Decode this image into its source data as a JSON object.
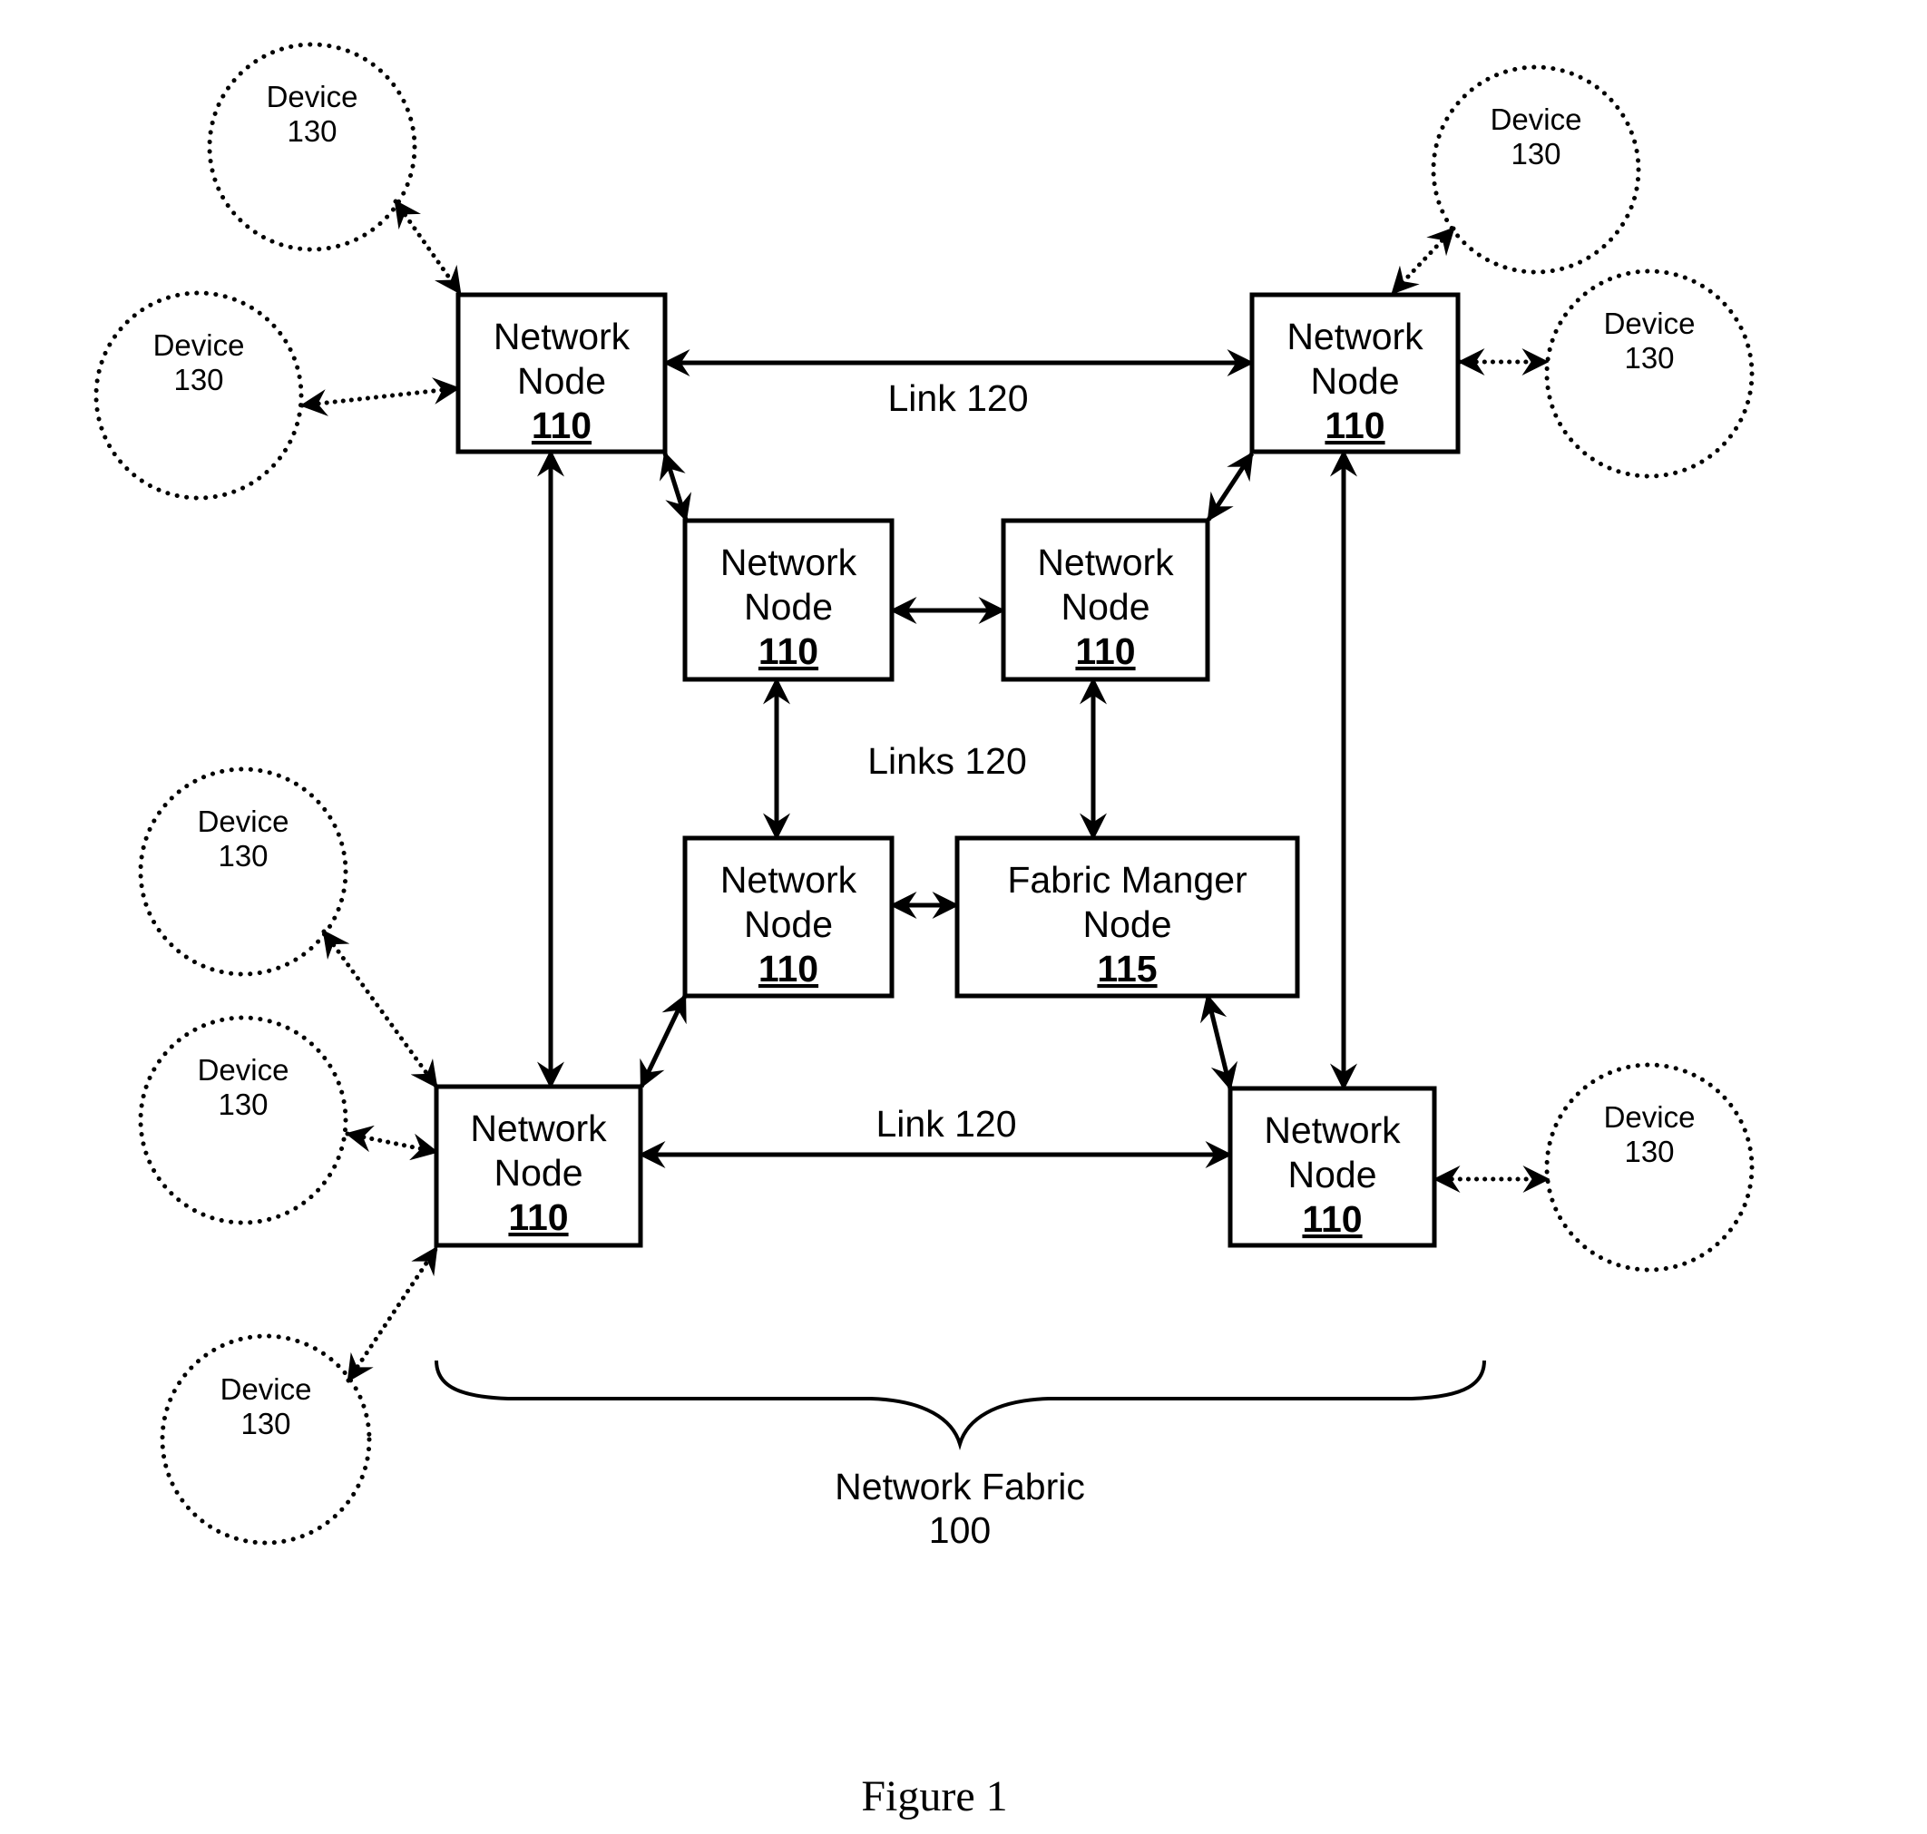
{
  "figure": {
    "caption": "Figure 1",
    "fabric_label": "Network Fabric",
    "fabric_id": "100"
  },
  "link_labels": {
    "top": "Link 120",
    "middle": "Links 120",
    "bottom": "Link 120"
  },
  "nodes": [
    {
      "key": "node-top-left",
      "line1": "Network",
      "line2": "Node",
      "id": "110"
    },
    {
      "key": "node-top-right",
      "line1": "Network",
      "line2": "Node",
      "id": "110"
    },
    {
      "key": "node-inner-top-left",
      "line1": "Network",
      "line2": "Node",
      "id": "110"
    },
    {
      "key": "node-inner-top-right",
      "line1": "Network",
      "line2": "Node",
      "id": "110"
    },
    {
      "key": "node-inner-bottom-left",
      "line1": "Network",
      "line2": "Node",
      "id": "110"
    },
    {
      "key": "fabric-manager-node",
      "line1": "Fabric Manger",
      "line2": "Node",
      "id": "115"
    },
    {
      "key": "node-bottom-left",
      "line1": "Network",
      "line2": "Node",
      "id": "110"
    },
    {
      "key": "node-bottom-right",
      "line1": "Network",
      "line2": "Node",
      "id": "110"
    }
  ],
  "devices": [
    {
      "key": "device-top-left-upper",
      "label": "Device",
      "id": "130",
      "attached_to": "node-top-left"
    },
    {
      "key": "device-top-left-lower",
      "label": "Device",
      "id": "130",
      "attached_to": "node-top-left"
    },
    {
      "key": "device-top-right-upper",
      "label": "Device",
      "id": "130",
      "attached_to": "node-top-right"
    },
    {
      "key": "device-top-right-lower",
      "label": "Device",
      "id": "130",
      "attached_to": "node-top-right"
    },
    {
      "key": "device-bottom-left-upper",
      "label": "Device",
      "id": "130",
      "attached_to": "node-bottom-left"
    },
    {
      "key": "device-bottom-left-middle",
      "label": "Device",
      "id": "130",
      "attached_to": "node-bottom-left"
    },
    {
      "key": "device-bottom-left-lower",
      "label": "Device",
      "id": "130",
      "attached_to": "node-bottom-left"
    },
    {
      "key": "device-bottom-right",
      "label": "Device",
      "id": "130",
      "attached_to": "node-bottom-right"
    }
  ],
  "links": [
    {
      "from": "node-top-left",
      "to": "node-top-right",
      "style": "solid",
      "bidirectional": true
    },
    {
      "from": "node-top-left",
      "to": "node-bottom-left",
      "style": "solid",
      "bidirectional": true
    },
    {
      "from": "node-top-right",
      "to": "node-bottom-right",
      "style": "solid",
      "bidirectional": true
    },
    {
      "from": "node-bottom-left",
      "to": "node-bottom-right",
      "style": "solid",
      "bidirectional": true
    },
    {
      "from": "node-top-left",
      "to": "node-inner-top-left",
      "style": "solid",
      "bidirectional": true
    },
    {
      "from": "node-top-right",
      "to": "node-inner-top-right",
      "style": "solid",
      "bidirectional": true
    },
    {
      "from": "node-inner-top-left",
      "to": "node-inner-top-right",
      "style": "solid",
      "bidirectional": true
    },
    {
      "from": "node-inner-top-left",
      "to": "node-inner-bottom-left",
      "style": "solid",
      "bidirectional": true
    },
    {
      "from": "node-inner-top-right",
      "to": "fabric-manager-node",
      "style": "solid",
      "bidirectional": true
    },
    {
      "from": "node-inner-bottom-left",
      "to": "fabric-manager-node",
      "style": "solid",
      "bidirectional": true
    },
    {
      "from": "node-inner-bottom-left",
      "to": "node-bottom-left",
      "style": "solid",
      "bidirectional": true
    },
    {
      "from": "fabric-manager-node",
      "to": "node-bottom-right",
      "style": "solid",
      "bidirectional": true
    }
  ]
}
